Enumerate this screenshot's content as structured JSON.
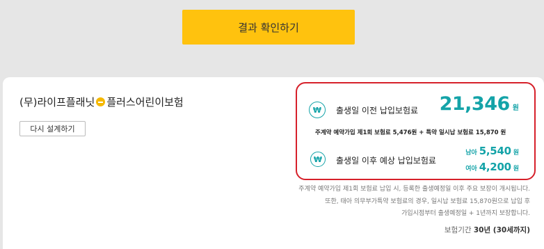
{
  "confirm_button": "결과 확인하기",
  "product": {
    "name_prefix": "(무)라이프플래닛",
    "name_suffix": "플러스어린이보험",
    "logo_icon": "coin-icon"
  },
  "redesign_button": "다시 설계하기",
  "premium": {
    "before_birth": {
      "icon": "won-icon",
      "label": "출생일 이전 납입보험료",
      "amount": "21,346",
      "unit": "원"
    },
    "breakdown": "주계약 예약가입 제1회 보험료 5,476원 + 특약 일시납 보험료 15,870 원",
    "after_birth": {
      "icon": "won-icon",
      "label": "출생일 이후 예상 납입보험료",
      "male_label": "남아",
      "male_amount": "5,540",
      "female_label": "여아",
      "female_amount": "4,200",
      "unit": "원"
    },
    "accent_color": "#14a3a8",
    "highlight_border_color": "#d6202a"
  },
  "notice": {
    "line1": "주계약 예약가입 제1회 보험료 납입 시, 등록한 출생예정일 이후 주요 보장이 개시됩니다.",
    "line2": "또한, 태아 의무부가특약 보험료의 경우, 일시납 보험료 15,870원으로 납입 후",
    "line3": "가입시점부터 출생예정일 + 1년까지 보장합니다."
  },
  "period": {
    "label": "보험기간",
    "value": "30년 (30세까지)"
  },
  "colors": {
    "button_yellow": "#ffc20e",
    "background": "#e6e6e6"
  }
}
